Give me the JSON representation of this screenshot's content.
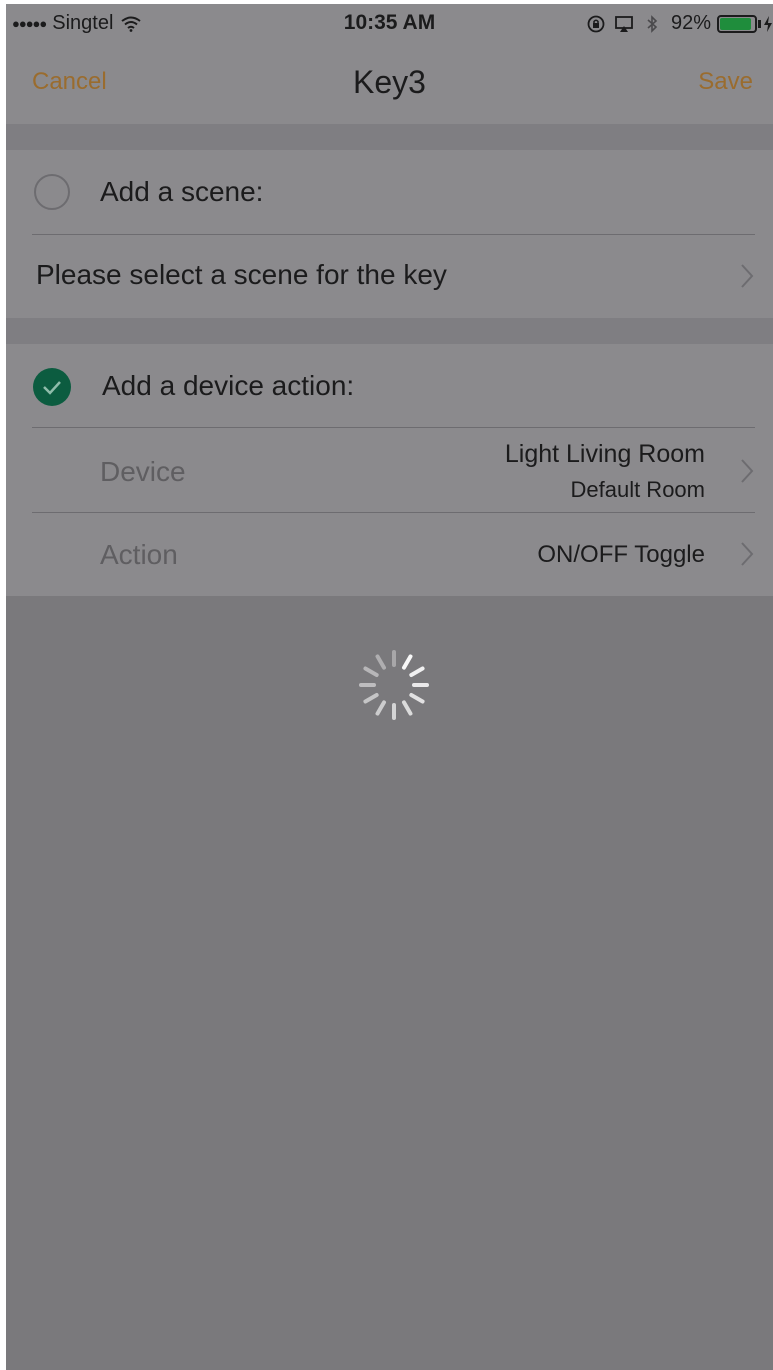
{
  "status_bar": {
    "signal": "●●●●●",
    "carrier": "Singtel",
    "time": "10:35 AM",
    "battery_percent": "92%",
    "battery_level": 0.92,
    "icons": [
      "wifi-icon",
      "orientation-lock-icon",
      "airplay-icon",
      "bluetooth-icon",
      "battery-icon",
      "charging-bolt-icon"
    ]
  },
  "nav": {
    "cancel_label": "Cancel",
    "title": "Key3",
    "save_label": "Save"
  },
  "scene_section": {
    "radio_selected": false,
    "label": "Add a scene:",
    "select_prompt": "Please select a scene for the key"
  },
  "device_section": {
    "radio_selected": true,
    "label": "Add a device action:",
    "device_label": "Device",
    "device_name": "Light Living Room",
    "device_room": "Default Room",
    "action_label": "Action",
    "action_value": "ON/OFF Toggle"
  },
  "loading": {
    "spinner": "activity-spinner-icon"
  },
  "colors": {
    "accent": "#9a6c2e",
    "check": "#0c5c40",
    "overlay_background": "#7a797c"
  }
}
